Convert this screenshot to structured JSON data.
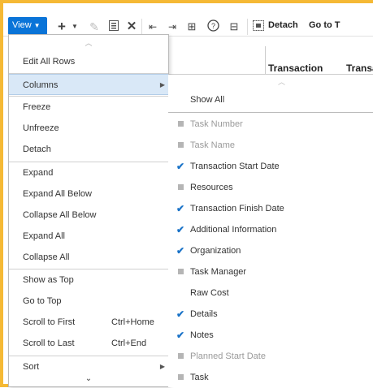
{
  "toolbar": {
    "view_label": "View",
    "detach_label": "Detach",
    "goto_label": "Go to T"
  },
  "table": {
    "columns": [
      "Transaction",
      "Transa"
    ]
  },
  "menu": {
    "items": [
      {
        "label": "Edit All Rows"
      },
      {
        "label": "Columns"
      },
      {
        "label": "Freeze"
      },
      {
        "label": "Unfreeze"
      },
      {
        "label": "Detach"
      },
      {
        "label": "Expand"
      },
      {
        "label": "Expand All Below"
      },
      {
        "label": "Collapse All Below"
      },
      {
        "label": "Expand All"
      },
      {
        "label": "Collapse All"
      },
      {
        "label": "Show as Top"
      },
      {
        "label": "Go to Top"
      },
      {
        "label": "Scroll to First",
        "shortcut": "Ctrl+Home"
      },
      {
        "label": "Scroll to Last",
        "shortcut": "Ctrl+End"
      },
      {
        "label": "Sort"
      }
    ]
  },
  "submenu": {
    "show_all": "Show All",
    "items": [
      {
        "label": "Task Number",
        "state": "disabled"
      },
      {
        "label": "Task Name",
        "state": "disabled"
      },
      {
        "label": "Transaction Start Date",
        "state": "checked"
      },
      {
        "label": "Resources",
        "state": "unchecked"
      },
      {
        "label": "Transaction Finish Date",
        "state": "checked"
      },
      {
        "label": "Additional Information",
        "state": "checked"
      },
      {
        "label": "Organization",
        "state": "checked"
      },
      {
        "label": "Task Manager",
        "state": "unchecked"
      },
      {
        "label": "Raw Cost",
        "state": "none"
      },
      {
        "label": "Details",
        "state": "checked"
      },
      {
        "label": "Notes",
        "state": "checked"
      },
      {
        "label": "Planned Start Date",
        "state": "disabled"
      },
      {
        "label": "Task",
        "state": "unchecked"
      }
    ]
  },
  "colors": {
    "accent": "#0a74d8",
    "frame": "#f5b935",
    "check": "#1a73c8",
    "selected_row": "#d9e8f7"
  }
}
